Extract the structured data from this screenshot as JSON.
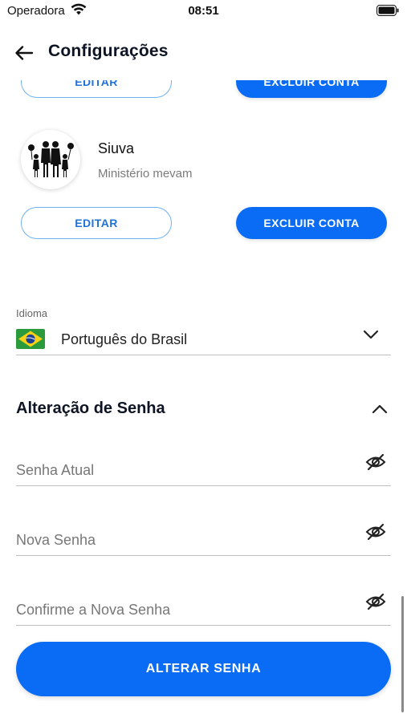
{
  "status_bar": {
    "carrier": "Operadora",
    "time": "08:51"
  },
  "header": {
    "title": "Configurações"
  },
  "accounts": [
    {
      "name": "",
      "organization": "",
      "edit_label": "EDITAR",
      "delete_label": "EXCLUIR CONTA"
    },
    {
      "name": "Siuva",
      "organization": "Ministério mevam",
      "edit_label": "EDITAR",
      "delete_label": "EXCLUIR CONTA"
    }
  ],
  "language": {
    "label": "Idioma",
    "value": "Português do Brasil",
    "flag_icon": "brazil-flag-icon"
  },
  "password_section": {
    "title": "Alteração de Senha",
    "fields": [
      {
        "placeholder": "Senha Atual"
      },
      {
        "placeholder": "Nova Senha"
      },
      {
        "placeholder": "Confirme a Nova Senha"
      }
    ],
    "submit_label": "ALTERAR SENHA"
  },
  "colors": {
    "primary": "#0a6cf5",
    "outline": "#6fb1ee",
    "title": "#0e1423"
  }
}
